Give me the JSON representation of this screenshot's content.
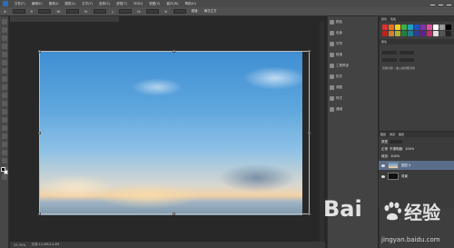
{
  "menubar": {
    "items": [
      "文件(F)",
      "编辑(E)",
      "图像(I)",
      "图层(L)",
      "文字(Y)",
      "选择(S)",
      "滤镜(T)",
      "3D(D)",
      "视图(V)",
      "窗口(W)",
      "帮助(H)"
    ]
  },
  "options": {
    "items": [
      "X:",
      "Y:",
      "W:",
      "H:",
      "△",
      "H:",
      "V:",
      "插值:",
      "两次立方"
    ]
  },
  "status": {
    "zoom": "33.33%",
    "doc": "文档:14.4M/14.4M"
  },
  "collapsed_panel": {
    "items": [
      "颜色",
      "色板",
      "字符",
      "段落",
      "工具预设",
      "历史",
      "调整",
      "样式",
      "通道"
    ]
  },
  "right_panel": {
    "tabs": [
      "颜色",
      "色板"
    ],
    "properties_tab": "属性",
    "note": "智能对象 - 嵌入的智能对象"
  },
  "layers": {
    "tabs": [
      "图层",
      "通道",
      "路径"
    ],
    "kind_label": "类型",
    "mode": "正常",
    "opacity_label": "不透明度:",
    "opacity": "100%",
    "fill_label": "填充:",
    "fill": "100%",
    "items": [
      "图层 0",
      "背景"
    ]
  },
  "swatch_colors": [
    "#e03030",
    "#f07020",
    "#f0d020",
    "#40b040",
    "#20a0c0",
    "#2050c0",
    "#8030b0",
    "#e050a0",
    "#ffffff",
    "#999999",
    "#000000",
    "#c02020",
    "#d08030",
    "#b0b030",
    "#208040",
    "#208090",
    "#304090",
    "#602090",
    "#c03070",
    "#dddddd",
    "#555555",
    "#222222"
  ],
  "watermark": {
    "brand_left": "Bai",
    "brand_right": "经验",
    "url": "jingyan.baidu.com"
  }
}
